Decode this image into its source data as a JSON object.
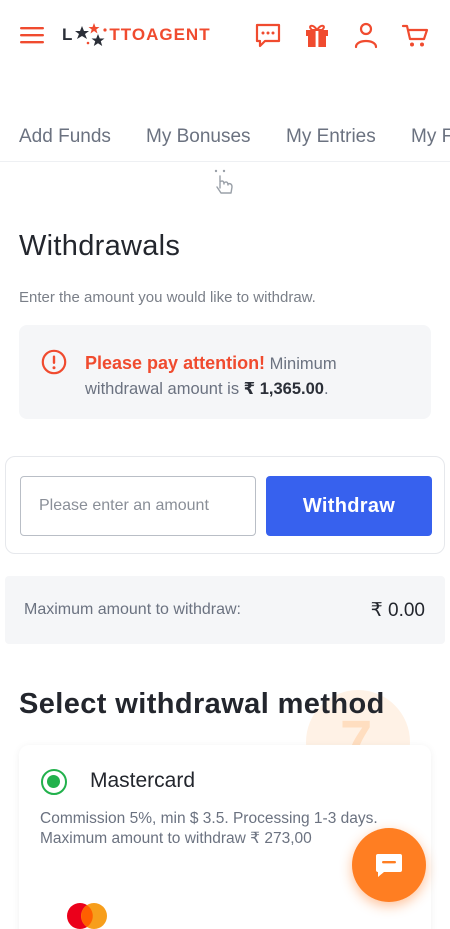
{
  "header": {
    "logo": {
      "letter_l": "L",
      "rest": "TTOAGENT"
    },
    "icons": [
      "menu-icon",
      "chat-icon",
      "gift-icon",
      "user-icon",
      "cart-icon"
    ]
  },
  "tabs": [
    {
      "label": "Add Funds"
    },
    {
      "label": "My Bonuses"
    },
    {
      "label": "My Entries"
    },
    {
      "label": "My F"
    }
  ],
  "page": {
    "title": "Withdrawals",
    "subtitle": "Enter the amount you would like to withdraw."
  },
  "notice": {
    "attention": "Please pay attention!",
    "text_1": " Minimum withdrawal amount is ",
    "amount": "₹ 1,365.00",
    "text_2": "."
  },
  "form": {
    "amount_placeholder": "Please enter an amount",
    "withdraw_label": "Withdraw"
  },
  "max": {
    "label": "Maximum amount to withdraw:",
    "value": "₹ 0.00"
  },
  "methods": {
    "title": "Select withdrawal method",
    "items": [
      {
        "name": "Mastercard",
        "commission": "Commission 5%, min $ 3.5. Processing 1-3 days.",
        "max": "Maximum amount to withdraw ₹ 273,00",
        "selected": true
      }
    ]
  },
  "colors": {
    "brand": "#f04b2f",
    "primary_button": "#3761ee",
    "radio": "#22b14c",
    "chat_fab": "#ff7e22"
  }
}
